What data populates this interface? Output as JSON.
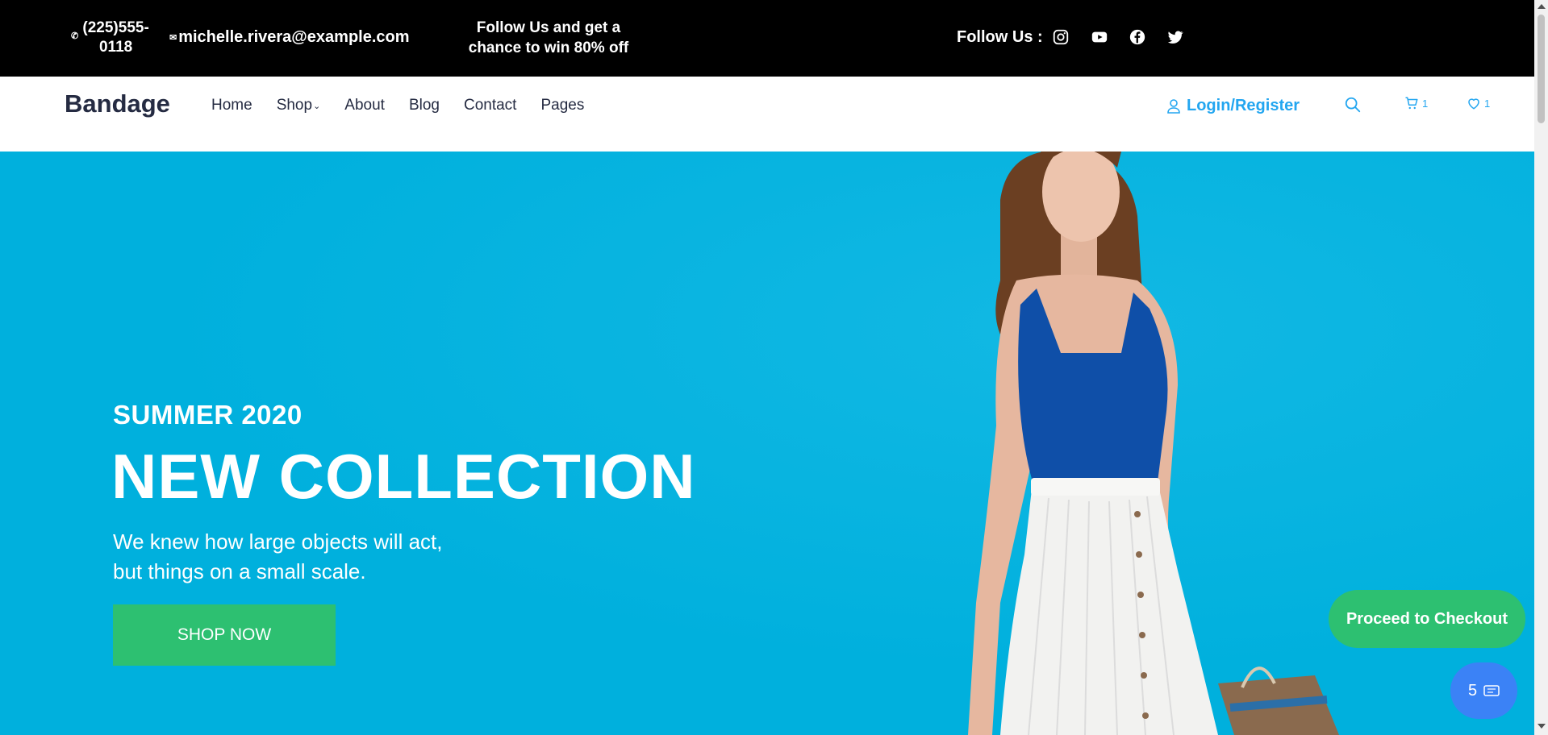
{
  "topbar": {
    "phone": "(225)555-0118",
    "email": "michelle.rivera@example.com",
    "promo": "Follow Us and get a chance to win 80% off",
    "follow_label": "Follow Us :",
    "social_icons": [
      "instagram-icon",
      "youtube-icon",
      "facebook-icon",
      "twitter-icon"
    ]
  },
  "nav": {
    "brand": "Bandage",
    "links": [
      "Home",
      "Shop",
      "About",
      "Blog",
      "Contact",
      "Pages"
    ],
    "login": "Login/Register",
    "cart_count": "1",
    "wishlist_count": "1"
  },
  "hero": {
    "season": "SUMMER 2020",
    "headline": "NEW COLLECTION",
    "description_line1": "We knew how large objects will act,",
    "description_line2": "but things on a small scale.",
    "cta": "SHOP NOW"
  },
  "floating": {
    "checkout": "Proceed to Checkout",
    "cart_items": "5"
  },
  "colors": {
    "topbar_bg": "#000000",
    "hero_bg": "#00B0DD",
    "accent_blue": "#23A6F0",
    "green": "#2DC071",
    "fab_blue": "#3B82F6"
  }
}
